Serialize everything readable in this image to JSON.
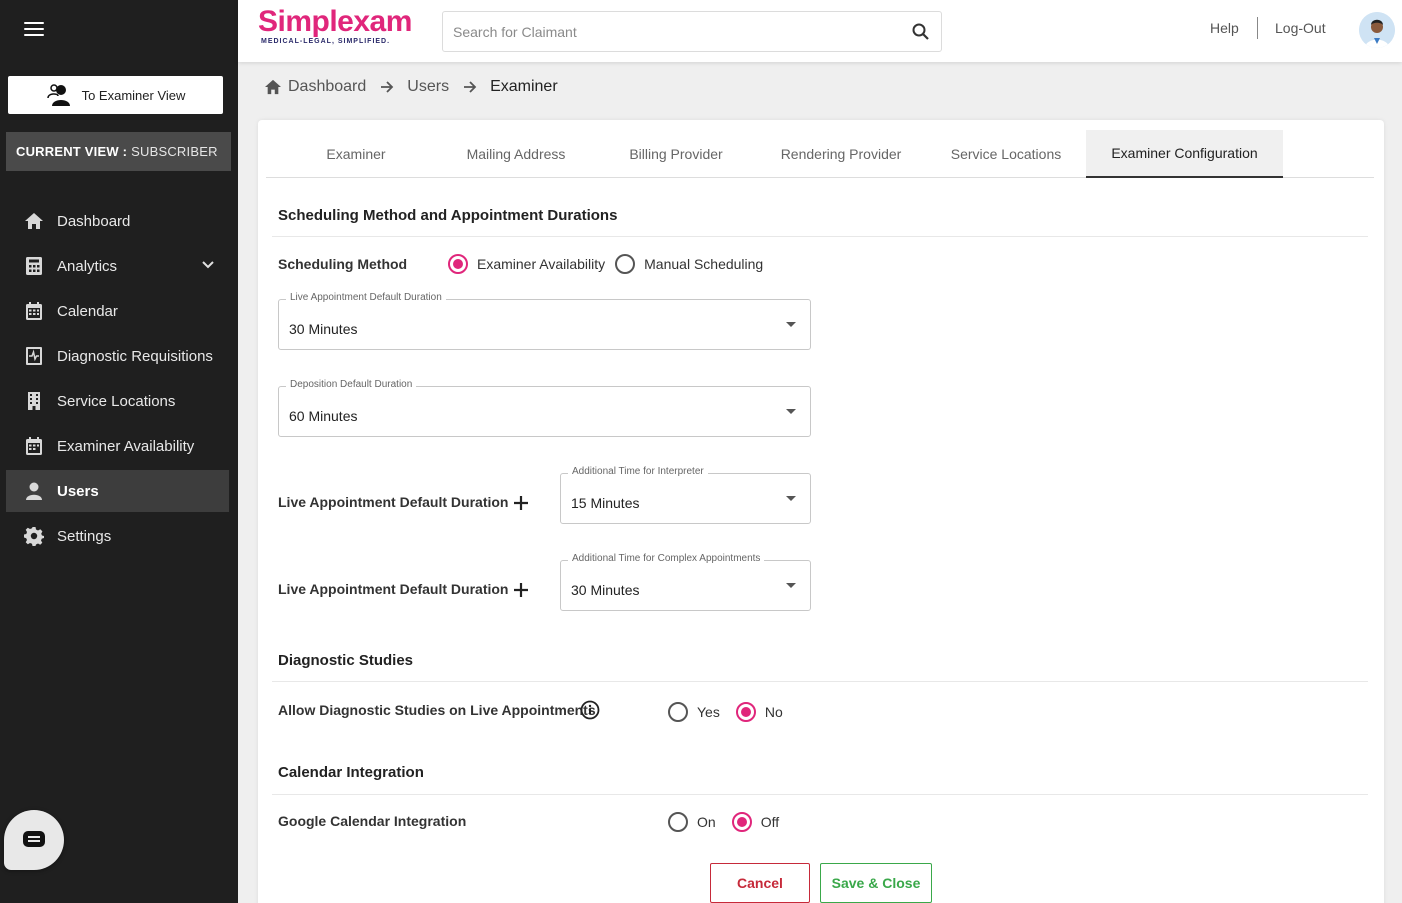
{
  "sidebar": {
    "examiner_view_label": "To Examiner View",
    "current_view_label": "CURRENT VIEW :",
    "current_view_value": "SUBSCRIBER",
    "items": [
      {
        "label": "Dashboard",
        "icon": "home-icon"
      },
      {
        "label": "Analytics",
        "icon": "calculator-icon"
      },
      {
        "label": "Calendar",
        "icon": "calendar-icon"
      },
      {
        "label": "Diagnostic Requisitions",
        "icon": "requisition-icon"
      },
      {
        "label": "Service Locations",
        "icon": "building-icon"
      },
      {
        "label": "Examiner Availability",
        "icon": "calendar-check-icon"
      },
      {
        "label": "Users",
        "icon": "user-icon",
        "active": true
      },
      {
        "label": "Settings",
        "icon": "gear-icon"
      }
    ]
  },
  "header": {
    "logo_text": "Simplexam",
    "logo_tagline": "MEDICAL-LEGAL, SIMPLIFIED.",
    "search_placeholder": "Search for Claimant",
    "help": "Help",
    "logout": "Log-Out"
  },
  "breadcrumb": [
    "Dashboard",
    "Users",
    "Examiner"
  ],
  "tabs": [
    "Examiner",
    "Mailing Address",
    "Billing Provider",
    "Rendering Provider",
    "Service Locations",
    "Examiner Configuration"
  ],
  "active_tab": "Examiner Configuration",
  "scheduling": {
    "title": "Scheduling Method and Appointment Durations",
    "method_label": "Scheduling Method",
    "options": [
      "Examiner Availability",
      "Manual Scheduling"
    ],
    "selected": "Examiner Availability",
    "live_duration": {
      "label": "Live Appointment Default Duration",
      "value": "30 Minutes"
    },
    "deposition_duration": {
      "label": "Deposition Default Duration",
      "value": "60 Minutes"
    },
    "interpreter_row": {
      "label": "Live Appointment Default Duration",
      "select_label": "Additional Time for Interpreter",
      "value": "15 Minutes"
    },
    "complex_row": {
      "label": "Live Appointment Default Duration",
      "select_label": "Additional Time for Complex Appointments",
      "value": "30 Minutes"
    }
  },
  "diagnostic": {
    "title": "Diagnostic Studies",
    "allow_label": "Allow Diagnostic Studies on Live Appointments",
    "options": [
      "Yes",
      "No"
    ],
    "selected": "No"
  },
  "calendar": {
    "title": "Calendar Integration",
    "google_label": "Google Calendar Integration",
    "options": [
      "On",
      "Off"
    ],
    "selected": "Off"
  },
  "actions": {
    "cancel": "Cancel",
    "save": "Save & Close"
  },
  "colors": {
    "accent": "#e0267b",
    "cancel": "#c62a3a",
    "save": "#3aa84a",
    "sidebar": "#1f1f1f"
  }
}
